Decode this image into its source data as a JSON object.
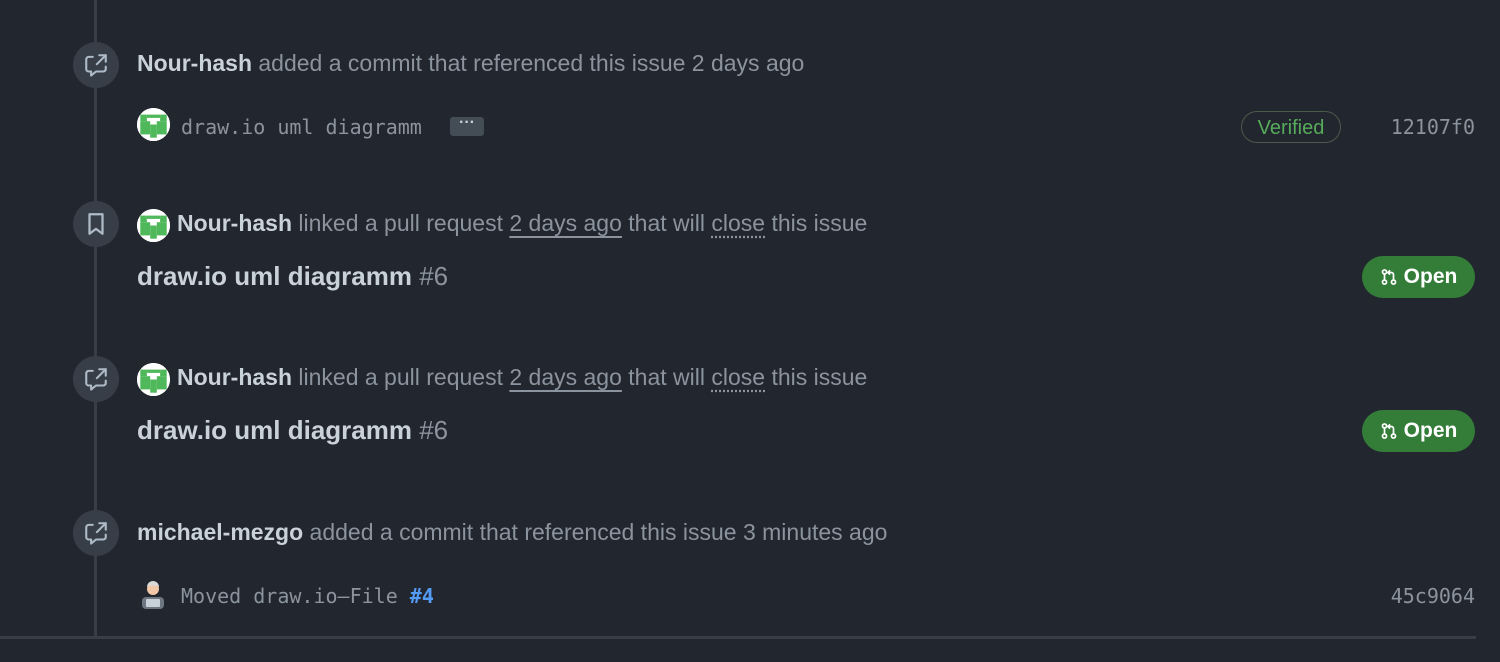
{
  "events": [
    {
      "author": "Nour-hash",
      "action": "added a commit that referenced this issue",
      "time": "2 days ago",
      "commit": {
        "message": "draw.io uml diagramm",
        "ellipsis": "···",
        "verified": "Verified",
        "sha": "12107f0"
      }
    },
    {
      "author": "Nour-hash",
      "action": "linked a pull request",
      "time": "2 days ago",
      "suffix_before": "that will",
      "close_word": "close",
      "suffix_after": "this issue",
      "pr": {
        "title": "draw.io uml diagramm",
        "number": "#6",
        "state": "Open"
      }
    },
    {
      "author": "Nour-hash",
      "action": "linked a pull request",
      "time": "2 days ago",
      "suffix_before": "that will",
      "close_word": "close",
      "suffix_after": "this issue",
      "pr": {
        "title": "draw.io uml diagramm",
        "number": "#6",
        "state": "Open"
      }
    },
    {
      "author": "michael-mezgo",
      "action": "added a commit that referenced this issue",
      "time": "3 minutes ago",
      "commit": {
        "message": "Moved draw.io–File",
        "issue_ref": "#4",
        "sha": "45c9064"
      }
    }
  ],
  "icons": {
    "cross_reference": "cross-reference-icon",
    "bookmark": "bookmark-icon",
    "pull_request": "git-pull-request-icon"
  },
  "colors": {
    "background": "#22262e",
    "accent_green": "#347d39",
    "verified_green": "#57ab5a",
    "link_blue": "#539bf5"
  }
}
